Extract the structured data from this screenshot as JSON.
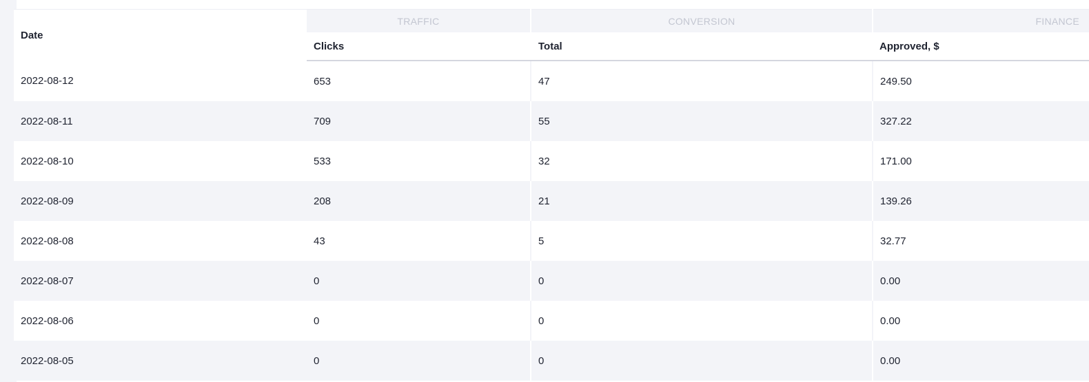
{
  "table": {
    "groups": {
      "traffic": "TRAFFIC",
      "conversion": "CONVERSION",
      "finance": "FINANCE"
    },
    "columns": {
      "date": "Date",
      "clicks": "Clicks",
      "total": "Total",
      "approved": "Approved, $"
    },
    "rows": [
      {
        "date": "2022-08-12",
        "clicks": "653",
        "total": "47",
        "approved": "249.50"
      },
      {
        "date": "2022-08-11",
        "clicks": "709",
        "total": "55",
        "approved": "327.22"
      },
      {
        "date": "2022-08-10",
        "clicks": "533",
        "total": "32",
        "approved": "171.00"
      },
      {
        "date": "2022-08-09",
        "clicks": "208",
        "total": "21",
        "approved": "139.26"
      },
      {
        "date": "2022-08-08",
        "clicks": "43",
        "total": "5",
        "approved": "32.77"
      },
      {
        "date": "2022-08-07",
        "clicks": "0",
        "total": "0",
        "approved": "0.00"
      },
      {
        "date": "2022-08-06",
        "clicks": "0",
        "total": "0",
        "approved": "0.00"
      },
      {
        "date": "2022-08-05",
        "clicks": "0",
        "total": "0",
        "approved": "0.00"
      }
    ]
  },
  "colors": {
    "background": "#f3f4f8",
    "panel": "#ffffff",
    "stripe": "#f3f4f8",
    "group_label": "#c3c6d1",
    "text": "#1f2330",
    "header_border": "#d4d6df"
  }
}
